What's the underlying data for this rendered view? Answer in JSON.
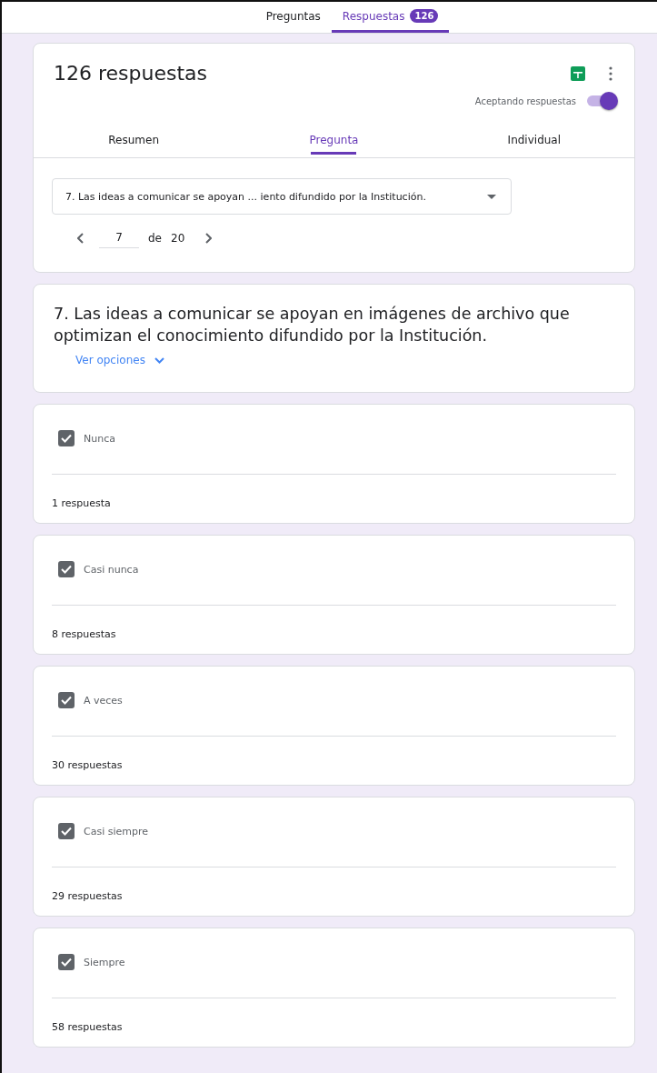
{
  "top_tabs": [
    {
      "label": "Preguntas",
      "selected": false
    },
    {
      "label": "Respuestas",
      "selected": true,
      "badge": "126"
    }
  ],
  "summary": {
    "title": "126 respuestas",
    "accepting_label": "Aceptando respuestas",
    "accepting": true,
    "tabs": [
      {
        "label": "Resumen",
        "selected": false
      },
      {
        "label": "Pregunta",
        "selected": true
      },
      {
        "label": "Individual",
        "selected": false
      }
    ],
    "question_select": "7. Las ideas a comunicar se apoyan ... iento difundido por la Institución.",
    "pager": {
      "current": "7",
      "of": "de",
      "total": "20"
    }
  },
  "question": {
    "text": "7. Las ideas a comunicar se apoyan en imágenes de archivo que optimizan el conocimiento difundido por la Institución.",
    "link": "Ver opciones"
  },
  "options": [
    {
      "label": "Nunca",
      "checked": true,
      "count": "1 respuesta"
    },
    {
      "label": "Casi nunca",
      "checked": true,
      "count": "8 respuestas"
    },
    {
      "label": "A veces",
      "checked": true,
      "count": "30 respuestas"
    },
    {
      "label": "Casi siempre",
      "checked": true,
      "count": "29 respuestas"
    },
    {
      "label": "Siempre",
      "checked": true,
      "count": "58 respuestas"
    }
  ]
}
